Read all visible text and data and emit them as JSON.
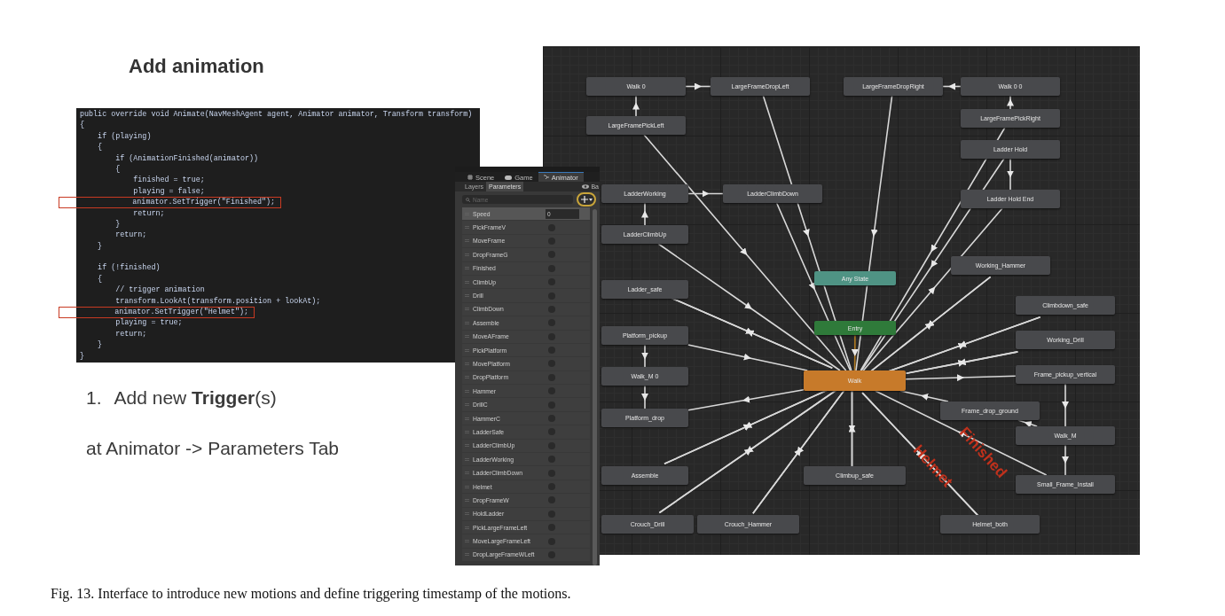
{
  "heading": "Add animation",
  "code": {
    "lines": [
      {
        "text": "public override void Animate(NavMeshAgent agent, Animator animator, Transform transform)",
        "highlighted": false
      },
      {
        "text": "{",
        "highlighted": false
      },
      {
        "text": "    if (playing)",
        "highlighted": false
      },
      {
        "text": "    {",
        "highlighted": false
      },
      {
        "text": "        if (AnimationFinished(animator))",
        "highlighted": false
      },
      {
        "text": "        {",
        "highlighted": false
      },
      {
        "text": "            finished = true;",
        "highlighted": false
      },
      {
        "text": "            playing = false;",
        "highlighted": false
      },
      {
        "text": "            animator.SetTrigger(\"Finished\");",
        "highlighted": true
      },
      {
        "text": "            return;",
        "highlighted": false
      },
      {
        "text": "        }",
        "highlighted": false
      },
      {
        "text": "        return;",
        "highlighted": false
      },
      {
        "text": "    }",
        "highlighted": false
      },
      {
        "text": "    if (!finished)",
        "highlighted": false
      },
      {
        "text": "    {",
        "highlighted": false
      },
      {
        "text": "        // trigger animation",
        "highlighted": false
      },
      {
        "text": "        transform.LookAt(transform.position + lookAt);",
        "highlighted": false
      },
      {
        "text": "        animator.SetTrigger(\"Helmet\");",
        "highlighted": true
      },
      {
        "text": "        playing = true;",
        "highlighted": false
      },
      {
        "text": "        return;",
        "highlighted": false
      },
      {
        "text": "    }",
        "highlighted": false
      },
      {
        "text": "}",
        "highlighted": false
      }
    ]
  },
  "steps": [
    {
      "number": "1.",
      "text": "Add new **Trigger**(s)"
    }
  ],
  "note": "at Animator -> Parameters Tab",
  "unity": {
    "tabs": [
      {
        "label": "Scene",
        "selected": false
      },
      {
        "label": "Game",
        "selected": false
      },
      {
        "label": "Animator",
        "selected": true
      }
    ],
    "subtabs": [
      {
        "label": "Layers",
        "selected": false
      },
      {
        "label": "Parameters",
        "selected": true
      }
    ],
    "clipped_label": "Ba",
    "search": {
      "placeholder": "Name"
    },
    "parameters": [
      {
        "name": "Speed",
        "kind": "float",
        "value": "0",
        "selected": true
      },
      {
        "name": "PickFrameV",
        "kind": "trigger"
      },
      {
        "name": "MoveFrame",
        "kind": "trigger"
      },
      {
        "name": "DropFrameG",
        "kind": "trigger"
      },
      {
        "name": "Finished",
        "kind": "trigger"
      },
      {
        "name": "ClimbUp",
        "kind": "trigger"
      },
      {
        "name": "Drill",
        "kind": "trigger"
      },
      {
        "name": "ClimbDown",
        "kind": "trigger"
      },
      {
        "name": "Assemble",
        "kind": "trigger"
      },
      {
        "name": "MoveAFrame",
        "kind": "trigger"
      },
      {
        "name": "PickPlatform",
        "kind": "trigger"
      },
      {
        "name": "MovePlatform",
        "kind": "trigger"
      },
      {
        "name": "DropPlatform",
        "kind": "trigger"
      },
      {
        "name": "Hammer",
        "kind": "trigger"
      },
      {
        "name": "DrillC",
        "kind": "trigger"
      },
      {
        "name": "HammerC",
        "kind": "trigger"
      },
      {
        "name": "LadderSafe",
        "kind": "trigger"
      },
      {
        "name": "LadderClimbUp",
        "kind": "trigger"
      },
      {
        "name": "LadderWorking",
        "kind": "trigger"
      },
      {
        "name": "LadderClimbDown",
        "kind": "trigger"
      },
      {
        "name": "Helmet",
        "kind": "trigger"
      },
      {
        "name": "DropFrameW",
        "kind": "trigger"
      },
      {
        "name": "HoldLadder",
        "kind": "trigger"
      },
      {
        "name": "PickLargeFrameLeft",
        "kind": "trigger"
      },
      {
        "name": "MoveLargeFrameLeft",
        "kind": "trigger"
      },
      {
        "name": "DropLargeFrameWLeft",
        "kind": "trigger"
      }
    ]
  },
  "graph": {
    "states": [
      {
        "name": "Walk 0",
        "kind": "state"
      },
      {
        "name": "LargeFrameDropLeft",
        "kind": "state"
      },
      {
        "name": "LargeFrameDropRight",
        "kind": "state"
      },
      {
        "name": "Walk 0 0",
        "kind": "state"
      },
      {
        "name": "LargeFramePickLeft",
        "kind": "state"
      },
      {
        "name": "LargeFramePickRight",
        "kind": "state"
      },
      {
        "name": "Ladder Hold",
        "kind": "state"
      },
      {
        "name": "LadderWorking",
        "kind": "state"
      },
      {
        "name": "LadderClimbDown",
        "kind": "state"
      },
      {
        "name": "Ladder Hold End",
        "kind": "state"
      },
      {
        "name": "LadderClimbUp",
        "kind": "state"
      },
      {
        "name": "Working_Hammer",
        "kind": "state"
      },
      {
        "name": "Any State",
        "kind": "any"
      },
      {
        "name": "Ladder_safe",
        "kind": "state"
      },
      {
        "name": "Climbdown_safe",
        "kind": "state"
      },
      {
        "name": "Entry",
        "kind": "entry"
      },
      {
        "name": "Platform_pickup",
        "kind": "state"
      },
      {
        "name": "Working_Drill",
        "kind": "state"
      },
      {
        "name": "Walk_M 0",
        "kind": "state"
      },
      {
        "name": "Walk",
        "kind": "default"
      },
      {
        "name": "Frame_pickup_vertical",
        "kind": "state"
      },
      {
        "name": "Frame_drop_ground",
        "kind": "state"
      },
      {
        "name": "Platform_drop",
        "kind": "state"
      },
      {
        "name": "Walk_M",
        "kind": "state"
      },
      {
        "name": "Assemble",
        "kind": "state"
      },
      {
        "name": "Climbup_safe",
        "kind": "state"
      },
      {
        "name": "Small_Frame_Install",
        "kind": "state"
      },
      {
        "name": "Crouch_Drill",
        "kind": "state"
      },
      {
        "name": "Crouch_Hammer",
        "kind": "state"
      },
      {
        "name": "Helmet_both",
        "kind": "state"
      }
    ],
    "annotations": [
      "Finished",
      "Helmet"
    ]
  },
  "caption": "Fig. 13. Interface to introduce new motions and define triggering timestamp of the motions."
}
